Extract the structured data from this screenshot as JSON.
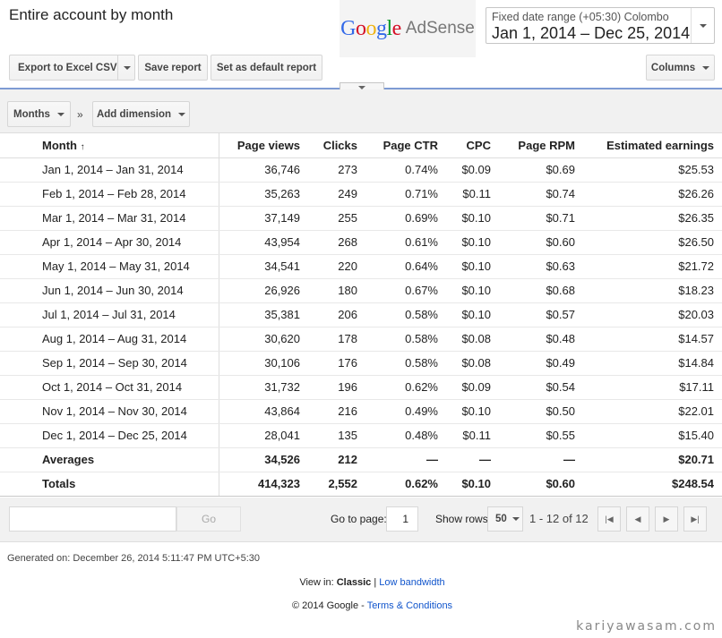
{
  "header": {
    "title": "Entire account by month",
    "logo": {
      "google_letters": [
        "G",
        "o",
        "o",
        "g",
        "l",
        "e"
      ],
      "google_colors": [
        "#3369e8",
        "#d50f25",
        "#eeb211",
        "#3369e8",
        "#009925",
        "#d50f25"
      ],
      "product": "AdSense"
    },
    "date_range": {
      "label": "Fixed date range (+05:30) Colombo",
      "value": "Jan 1, 2014 – Dec 25, 2014"
    }
  },
  "toolbar": {
    "export_label": "Export to Excel CSV",
    "save_label": "Save report",
    "default_label": "Set as default report",
    "columns_label": "Columns"
  },
  "dimensions": {
    "months_label": "Months",
    "chevron": "»",
    "add_dimension_label": "Add dimension"
  },
  "table": {
    "headers": [
      "Month",
      "Page views",
      "Clicks",
      "Page CTR",
      "CPC",
      "Page RPM",
      "Estimated earnings"
    ],
    "sort_indicator": "↑",
    "rows": [
      [
        "Jan 1, 2014 – Jan 31, 2014",
        "36,746",
        "273",
        "0.74%",
        "$0.09",
        "$0.69",
        "$25.53"
      ],
      [
        "Feb 1, 2014 – Feb 28, 2014",
        "35,263",
        "249",
        "0.71%",
        "$0.11",
        "$0.74",
        "$26.26"
      ],
      [
        "Mar 1, 2014 – Mar 31, 2014",
        "37,149",
        "255",
        "0.69%",
        "$0.10",
        "$0.71",
        "$26.35"
      ],
      [
        "Apr 1, 2014 – Apr 30, 2014",
        "43,954",
        "268",
        "0.61%",
        "$0.10",
        "$0.60",
        "$26.50"
      ],
      [
        "May 1, 2014 – May 31, 2014",
        "34,541",
        "220",
        "0.64%",
        "$0.10",
        "$0.63",
        "$21.72"
      ],
      [
        "Jun 1, 2014 – Jun 30, 2014",
        "26,926",
        "180",
        "0.67%",
        "$0.10",
        "$0.68",
        "$18.23"
      ],
      [
        "Jul 1, 2014 – Jul 31, 2014",
        "35,381",
        "206",
        "0.58%",
        "$0.10",
        "$0.57",
        "$20.03"
      ],
      [
        "Aug 1, 2014 – Aug 31, 2014",
        "30,620",
        "178",
        "0.58%",
        "$0.08",
        "$0.48",
        "$14.57"
      ],
      [
        "Sep 1, 2014 – Sep 30, 2014",
        "30,106",
        "176",
        "0.58%",
        "$0.08",
        "$0.49",
        "$14.84"
      ],
      [
        "Oct 1, 2014 – Oct 31, 2014",
        "31,732",
        "196",
        "0.62%",
        "$0.09",
        "$0.54",
        "$17.11"
      ],
      [
        "Nov 1, 2014 – Nov 30, 2014",
        "43,864",
        "216",
        "0.49%",
        "$0.10",
        "$0.50",
        "$22.01"
      ],
      [
        "Dec 1, 2014 – Dec 25, 2014",
        "28,041",
        "135",
        "0.48%",
        "$0.11",
        "$0.55",
        "$15.40"
      ]
    ],
    "averages": [
      "Averages",
      "34,526",
      "212",
      "—",
      "—",
      "—",
      "$20.71"
    ],
    "totals": [
      "Totals",
      "414,323",
      "2,552",
      "0.62%",
      "$0.10",
      "$0.60",
      "$248.54"
    ]
  },
  "pager": {
    "search_value": "",
    "go_label": "Go",
    "goto_label": "Go to page:",
    "page_value": "1",
    "show_rows_label": "Show rows:",
    "rows_value": "50",
    "range_text": "1 - 12 of 12"
  },
  "footer": {
    "generated": "Generated on: December 26, 2014 5:11:47 PM UTC+5:30",
    "view_in_label": "View in:",
    "view_classic": "Classic",
    "view_separator": "|",
    "view_low_bandwidth": "Low bandwidth",
    "copyright": "© 2014 Google -",
    "terms": "Terms & Conditions",
    "watermark": "kariyawasam.com"
  }
}
